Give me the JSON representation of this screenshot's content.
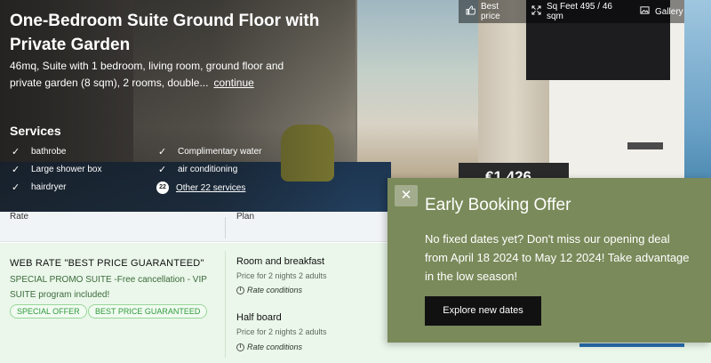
{
  "hero": {
    "title": "One-Bedroom Suite Ground Floor with Private Garden",
    "description": "46mq, Suite with 1 bedroom, living room, ground floor and private garden (8 sqm), 2 rooms, double...",
    "continue_label": "continue",
    "price_partial": "€1.426",
    "tags": [
      {
        "icon": "thumbs-up-icon",
        "label": "Best price"
      },
      {
        "icon": "expand-icon",
        "label": "Sq Feet 495 / 46 sqm"
      },
      {
        "icon": "image-icon",
        "label": "Gallery"
      }
    ],
    "services": {
      "heading": "Services",
      "items": [
        "bathrobe",
        "Large shower box",
        "hairdryer",
        "Complimentary water",
        "air conditioning"
      ],
      "more_count": "22",
      "more_label": "Other 22 services"
    }
  },
  "table": {
    "headers": {
      "rate": "Rate",
      "plan": "Plan"
    },
    "rate": {
      "title": "WEB RATE \"BEST PRICE GUARANTEED\"",
      "description": "SPECIAL PROMO SUITE -Free cancellation - VIP SUITE program included!",
      "badges": [
        "SPECIAL OFFER",
        "BEST PRICE GUARANTEED"
      ]
    },
    "plans": [
      {
        "name": "Room and breakfast",
        "sub": "Price for 2 nights  2 adults",
        "conditions": "Rate conditions"
      },
      {
        "name": "Half board",
        "sub": "Price for 2 nights  2 adults",
        "conditions": "Rate conditions"
      }
    ]
  },
  "overlay": {
    "close_label": "✕",
    "title": "Early Booking Offer",
    "body": "No fixed dates yet? Don't miss our opening deal from April 18 2024 to May 12 2024! Take advantage in the low season!",
    "button_label": "Explore new dates"
  },
  "colors": {
    "overlay_bg": "#7a8a5a",
    "row_bg": "#eaf7ea",
    "badge_green": "#2e9b3c",
    "button_bg": "#111111"
  }
}
